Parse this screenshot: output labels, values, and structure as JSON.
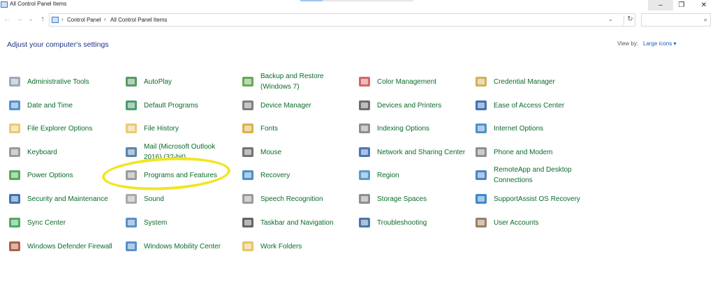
{
  "window": {
    "title": "All Control Panel Items",
    "minimize": "–",
    "maximize": "❐",
    "close": "✕"
  },
  "nav": {
    "back": "←",
    "forward": "→",
    "recent": "⌄",
    "up": "↑",
    "breadcrumb": [
      "Control Panel",
      "All Control Panel Items"
    ],
    "separator": "›",
    "dropdown": "⌄",
    "refresh": "↻",
    "search_placeholder": "",
    "search_icon": "⌕"
  },
  "header": {
    "title": "Adjust your computer's settings",
    "view_by_label": "View by:",
    "view_by_value": "Large icons ▾"
  },
  "colors": {
    "link": "#0b6b2a",
    "heading": "#1e3287",
    "highlight": "#f2e51e"
  },
  "items": [
    {
      "label": "Administrative Tools",
      "icon": "admin-tools-icon"
    },
    {
      "label": "AutoPlay",
      "icon": "autoplay-icon"
    },
    {
      "label": "Backup and Restore (Windows 7)",
      "icon": "backup-icon"
    },
    {
      "label": "Color Management",
      "icon": "color-management-icon"
    },
    {
      "label": "Credential Manager",
      "icon": "credential-icon"
    },
    {
      "label": "Date and Time",
      "icon": "calendar-clock-icon"
    },
    {
      "label": "Default Programs",
      "icon": "default-programs-icon"
    },
    {
      "label": "Device Manager",
      "icon": "device-manager-icon"
    },
    {
      "label": "Devices and Printers",
      "icon": "printer-icon"
    },
    {
      "label": "Ease of Access Center",
      "icon": "ease-access-icon"
    },
    {
      "label": "File Explorer Options",
      "icon": "folder-options-icon"
    },
    {
      "label": "File History",
      "icon": "file-history-icon"
    },
    {
      "label": "Fonts",
      "icon": "fonts-icon"
    },
    {
      "label": "Indexing Options",
      "icon": "indexing-icon"
    },
    {
      "label": "Internet Options",
      "icon": "globe-icon"
    },
    {
      "label": "Keyboard",
      "icon": "keyboard-icon"
    },
    {
      "label": "Mail (Microsoft Outlook 2016) (32-bit)",
      "icon": "mail-icon"
    },
    {
      "label": "Mouse",
      "icon": "mouse-icon"
    },
    {
      "label": "Network and Sharing Center",
      "icon": "network-icon"
    },
    {
      "label": "Phone and Modem",
      "icon": "phone-icon"
    },
    {
      "label": "Power Options",
      "icon": "power-icon"
    },
    {
      "label": "Programs and Features",
      "icon": "programs-icon"
    },
    {
      "label": "Recovery",
      "icon": "recovery-icon"
    },
    {
      "label": "Region",
      "icon": "region-icon"
    },
    {
      "label": "RemoteApp and Desktop Connections",
      "icon": "remoteapp-icon"
    },
    {
      "label": "Security and Maintenance",
      "icon": "flag-icon"
    },
    {
      "label": "Sound",
      "icon": "speaker-icon"
    },
    {
      "label": "Speech Recognition",
      "icon": "microphone-icon"
    },
    {
      "label": "Storage Spaces",
      "icon": "storage-icon"
    },
    {
      "label": "SupportAssist OS Recovery",
      "icon": "supportassist-icon"
    },
    {
      "label": "Sync Center",
      "icon": "sync-icon"
    },
    {
      "label": "System",
      "icon": "system-icon"
    },
    {
      "label": "Taskbar and Navigation",
      "icon": "taskbar-icon"
    },
    {
      "label": "Troubleshooting",
      "icon": "troubleshoot-icon"
    },
    {
      "label": "User Accounts",
      "icon": "users-icon"
    },
    {
      "label": "Windows Defender Firewall",
      "icon": "firewall-icon"
    },
    {
      "label": "Windows Mobility Center",
      "icon": "mobility-icon"
    },
    {
      "label": "Work Folders",
      "icon": "work-folders-icon"
    }
  ]
}
